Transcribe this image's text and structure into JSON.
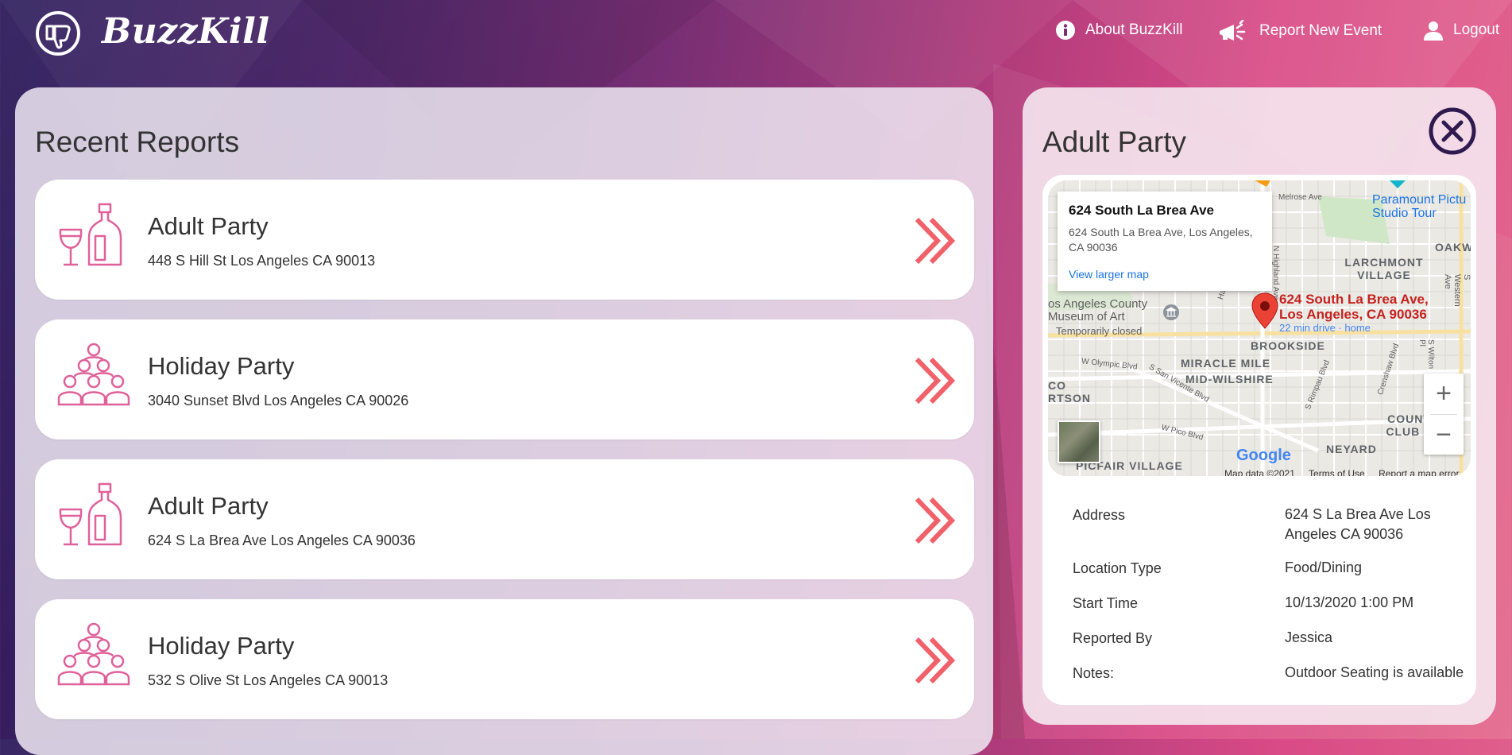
{
  "header": {
    "brand": "BuzzKill",
    "nav": {
      "about": "About BuzzKill",
      "report": "Report New Event",
      "logout": "Logout"
    }
  },
  "reports": {
    "title": "Recent Reports",
    "items": [
      {
        "title": "Adult Party",
        "address": "448 S Hill St Los Angeles CA 90013",
        "icon": "wine-icon"
      },
      {
        "title": "Holiday Party",
        "address": "3040 Sunset Blvd Los Angeles CA 90026",
        "icon": "crowd-icon"
      },
      {
        "title": "Adult Party",
        "address": "624 S La Brea Ave Los Angeles CA 90036",
        "icon": "wine-icon"
      },
      {
        "title": "Holiday Party",
        "address": "532 S Olive St Los Angeles CA 90013",
        "icon": "crowd-icon"
      }
    ]
  },
  "detail": {
    "title": "Adult Party",
    "map": {
      "popup_title": "624 South La Brea Ave",
      "popup_address": "624 South La Brea Ave, Los Angeles, CA 90036",
      "popup_link": "View larger map",
      "pin_label": "624 South La Brea Ave, Los Angeles, CA 90036",
      "pin_sub": "22 min drive · home",
      "labels": {
        "paramount": "Paramount Pictu Studio Tour",
        "larchmont": "LARCHMONT VILLAGE",
        "oakwo": "OAKWO",
        "museum": "os Angeles County Museum of Art",
        "museum_sub": "Temporarily closed",
        "brookside": "BROOKSIDE",
        "miracle": "MIRACLE MILE",
        "midwilshire": "MID-WILSHIRE",
        "co": "CO",
        "rtson": "RTSON",
        "country": "COUNTRY CLUB PAR",
        "vineyard": "NEYARD",
        "picfair": "PICFAIR VILLAGE",
        "melrose": "Melrose Ave",
        "highland": "N Highland Ave",
        "western": "S Western Ave",
        "olympic": "W Olympic Blvd",
        "sanvicente": "S San Vicente Blvd",
        "pico": "W Pico Blvd",
        "hauser": "Hauser Blvd",
        "rimpau": "S Rimpau Blvd",
        "crenshaw": "Crenshaw Blvd",
        "wilton": "S Wilton Pl"
      },
      "zoom_in": "+",
      "zoom_out": "−",
      "google": "Google",
      "footer": {
        "data": "Map data ©2021",
        "terms": "Terms of Use",
        "report": "Report a map error"
      }
    },
    "fields": [
      {
        "label": "Address",
        "value": "624 S La Brea Ave Los Angeles CA 90036"
      },
      {
        "label": "Location Type",
        "value": "Food/Dining"
      },
      {
        "label": "Start Time",
        "value": "10/13/2020 1:00 PM"
      },
      {
        "label": "Reported By",
        "value": "Jessica"
      },
      {
        "label": "Notes:",
        "value": "Outdoor Seating is available"
      }
    ]
  },
  "colors": {
    "accent": "#f0616a",
    "icon_pink": "#e0609a",
    "close": "#2e1a4f"
  }
}
